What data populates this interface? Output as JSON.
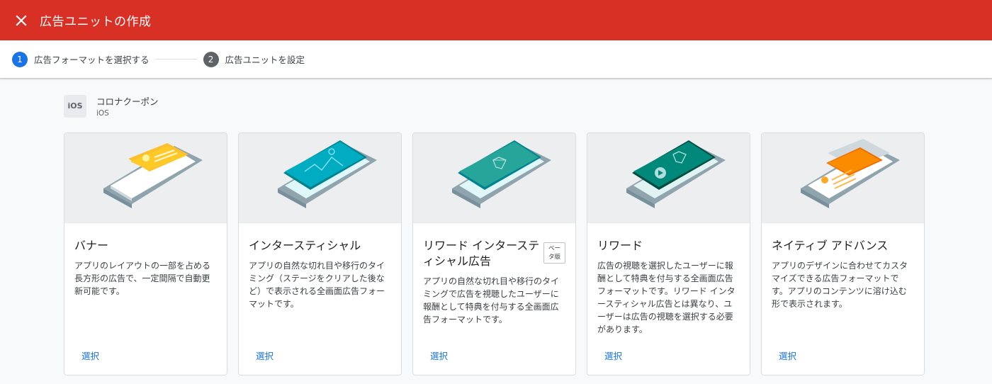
{
  "header": {
    "title": "広告ユニットの作成",
    "close_icon": "close-icon"
  },
  "stepper": {
    "steps": [
      {
        "number": "1",
        "label": "広告フォーマットを選択する"
      },
      {
        "number": "2",
        "label": "広告ユニットを設定"
      }
    ]
  },
  "app": {
    "icon_text": "iOS",
    "name": "コロナクーポン",
    "platform": "iOS"
  },
  "colors": {
    "header_bg": "#d93025",
    "accent": "#1a73e8"
  },
  "cards": [
    {
      "title": "バナー",
      "badge": "",
      "description": "アプリのレイアウトの一部を占める長方形の広告で、一定間隔で自動更新可能です。",
      "select": "選択"
    },
    {
      "title": "インタースティシャル",
      "badge": "",
      "description": "アプリの自然な切れ目や移行のタイミング（ステージをクリアした後など）で表示される全画面広告フォーマットです。",
      "select": "選択"
    },
    {
      "title": "リワード インタースティシャル広告",
      "badge": "ベータ版",
      "description": "アプリの自然な切れ目や移行のタイミングで広告を視聴したユーザーに報酬として特典を付与する全画面広告フォーマットです。",
      "select": "選択"
    },
    {
      "title": "リワード",
      "badge": "",
      "description": "広告の視聴を選択したユーザーに報酬として特典を付与する全画面広告フォーマットです。リワード インタースティシャル広告とは異なり、ユーザーは広告の視聴を選択する必要があります。",
      "select": "選択"
    },
    {
      "title": "ネイティブ アドバンス",
      "badge": "",
      "description": "アプリのデザインに合わせてカスタマイズできる広告フォーマットです。アプリのコンテンツに溶け込む形で表示されます。",
      "select": "選択"
    }
  ]
}
